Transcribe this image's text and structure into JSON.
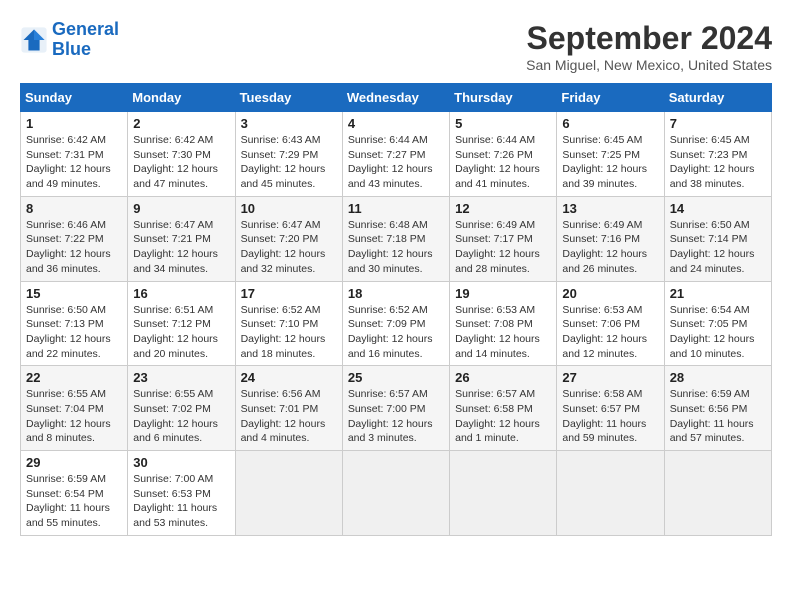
{
  "header": {
    "logo_line1": "General",
    "logo_line2": "Blue",
    "month": "September 2024",
    "location": "San Miguel, New Mexico, United States"
  },
  "weekdays": [
    "Sunday",
    "Monday",
    "Tuesday",
    "Wednesday",
    "Thursday",
    "Friday",
    "Saturday"
  ],
  "weeks": [
    [
      {
        "day": "1",
        "info": "Sunrise: 6:42 AM\nSunset: 7:31 PM\nDaylight: 12 hours\nand 49 minutes."
      },
      {
        "day": "2",
        "info": "Sunrise: 6:42 AM\nSunset: 7:30 PM\nDaylight: 12 hours\nand 47 minutes."
      },
      {
        "day": "3",
        "info": "Sunrise: 6:43 AM\nSunset: 7:29 PM\nDaylight: 12 hours\nand 45 minutes."
      },
      {
        "day": "4",
        "info": "Sunrise: 6:44 AM\nSunset: 7:27 PM\nDaylight: 12 hours\nand 43 minutes."
      },
      {
        "day": "5",
        "info": "Sunrise: 6:44 AM\nSunset: 7:26 PM\nDaylight: 12 hours\nand 41 minutes."
      },
      {
        "day": "6",
        "info": "Sunrise: 6:45 AM\nSunset: 7:25 PM\nDaylight: 12 hours\nand 39 minutes."
      },
      {
        "day": "7",
        "info": "Sunrise: 6:45 AM\nSunset: 7:23 PM\nDaylight: 12 hours\nand 38 minutes."
      }
    ],
    [
      {
        "day": "8",
        "info": "Sunrise: 6:46 AM\nSunset: 7:22 PM\nDaylight: 12 hours\nand 36 minutes."
      },
      {
        "day": "9",
        "info": "Sunrise: 6:47 AM\nSunset: 7:21 PM\nDaylight: 12 hours\nand 34 minutes."
      },
      {
        "day": "10",
        "info": "Sunrise: 6:47 AM\nSunset: 7:20 PM\nDaylight: 12 hours\nand 32 minutes."
      },
      {
        "day": "11",
        "info": "Sunrise: 6:48 AM\nSunset: 7:18 PM\nDaylight: 12 hours\nand 30 minutes."
      },
      {
        "day": "12",
        "info": "Sunrise: 6:49 AM\nSunset: 7:17 PM\nDaylight: 12 hours\nand 28 minutes."
      },
      {
        "day": "13",
        "info": "Sunrise: 6:49 AM\nSunset: 7:16 PM\nDaylight: 12 hours\nand 26 minutes."
      },
      {
        "day": "14",
        "info": "Sunrise: 6:50 AM\nSunset: 7:14 PM\nDaylight: 12 hours\nand 24 minutes."
      }
    ],
    [
      {
        "day": "15",
        "info": "Sunrise: 6:50 AM\nSunset: 7:13 PM\nDaylight: 12 hours\nand 22 minutes."
      },
      {
        "day": "16",
        "info": "Sunrise: 6:51 AM\nSunset: 7:12 PM\nDaylight: 12 hours\nand 20 minutes."
      },
      {
        "day": "17",
        "info": "Sunrise: 6:52 AM\nSunset: 7:10 PM\nDaylight: 12 hours\nand 18 minutes."
      },
      {
        "day": "18",
        "info": "Sunrise: 6:52 AM\nSunset: 7:09 PM\nDaylight: 12 hours\nand 16 minutes."
      },
      {
        "day": "19",
        "info": "Sunrise: 6:53 AM\nSunset: 7:08 PM\nDaylight: 12 hours\nand 14 minutes."
      },
      {
        "day": "20",
        "info": "Sunrise: 6:53 AM\nSunset: 7:06 PM\nDaylight: 12 hours\nand 12 minutes."
      },
      {
        "day": "21",
        "info": "Sunrise: 6:54 AM\nSunset: 7:05 PM\nDaylight: 12 hours\nand 10 minutes."
      }
    ],
    [
      {
        "day": "22",
        "info": "Sunrise: 6:55 AM\nSunset: 7:04 PM\nDaylight: 12 hours\nand 8 minutes."
      },
      {
        "day": "23",
        "info": "Sunrise: 6:55 AM\nSunset: 7:02 PM\nDaylight: 12 hours\nand 6 minutes."
      },
      {
        "day": "24",
        "info": "Sunrise: 6:56 AM\nSunset: 7:01 PM\nDaylight: 12 hours\nand 4 minutes."
      },
      {
        "day": "25",
        "info": "Sunrise: 6:57 AM\nSunset: 7:00 PM\nDaylight: 12 hours\nand 3 minutes."
      },
      {
        "day": "26",
        "info": "Sunrise: 6:57 AM\nSunset: 6:58 PM\nDaylight: 12 hours\nand 1 minute."
      },
      {
        "day": "27",
        "info": "Sunrise: 6:58 AM\nSunset: 6:57 PM\nDaylight: 11 hours\nand 59 minutes."
      },
      {
        "day": "28",
        "info": "Sunrise: 6:59 AM\nSunset: 6:56 PM\nDaylight: 11 hours\nand 57 minutes."
      }
    ],
    [
      {
        "day": "29",
        "info": "Sunrise: 6:59 AM\nSunset: 6:54 PM\nDaylight: 11 hours\nand 55 minutes."
      },
      {
        "day": "30",
        "info": "Sunrise: 7:00 AM\nSunset: 6:53 PM\nDaylight: 11 hours\nand 53 minutes."
      },
      null,
      null,
      null,
      null,
      null
    ]
  ]
}
